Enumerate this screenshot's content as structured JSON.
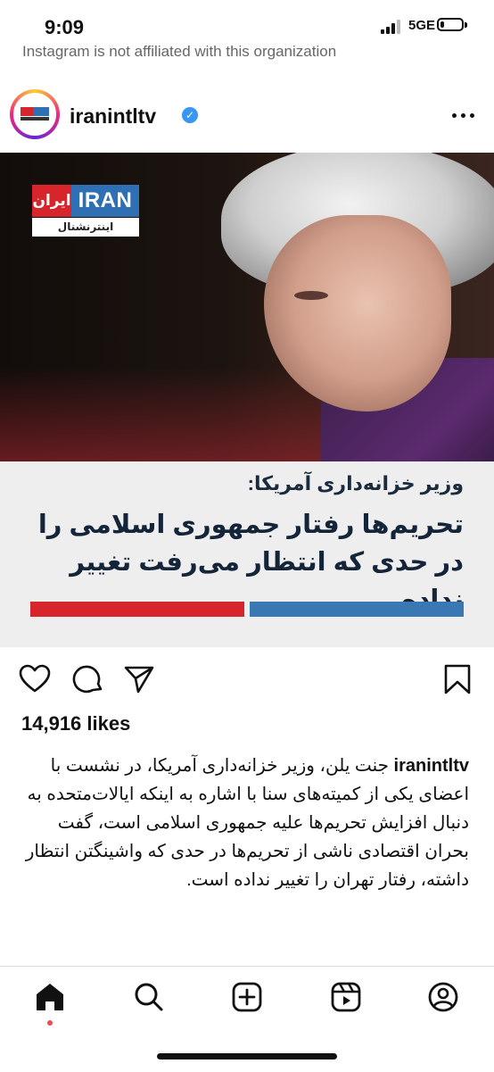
{
  "status_bar": {
    "time": "9:09",
    "network": "5GE",
    "battery_level": 0.2
  },
  "previous_post": {
    "caption_fragment": "Instagram is not affiliated with this organization"
  },
  "post": {
    "username": "iranintltv",
    "verified": true,
    "more_icon": "more-horizontal-icon",
    "image": {
      "logo_red_text": "ایران",
      "logo_blue_text": "IRAN",
      "logo_subtitle": "اینترنشنال",
      "kicker": "وزیر خزانه‌داری آمریکا:",
      "headline": "تحریم‌ها رفتار جمهوری اسلامی را در حدی که انتظار می‌رفت تغییر نداده",
      "bar_colors": [
        "#d7262b",
        "#3a78b4"
      ]
    },
    "actions": {
      "like_icon": "heart-icon",
      "comment_icon": "comment-icon",
      "share_icon": "send-icon",
      "save_icon": "bookmark-icon"
    },
    "likes": "14,916 likes",
    "caption": {
      "user": "iranintltv",
      "text": "جنت یلن، وزیر خزانه‌داری آمریکا، در نشست با اعضای یکی از کمیته‌های سنا با اشاره به اینکه ایالات‌متحده به دنبال افزایش تحریم‌ها علیه جمهوری اسلامی است، گفت بحران اقتصادی ناشی از تحریم‌ها در حدی که واشینگتن انتظار داشته، رفتار تهران را تغییر نداده است."
    }
  },
  "bottom_nav": {
    "items": [
      "home-icon",
      "search-icon",
      "create-icon",
      "reels-icon",
      "profile-icon"
    ],
    "active": "home-icon",
    "notification_color": "#ed4956"
  }
}
